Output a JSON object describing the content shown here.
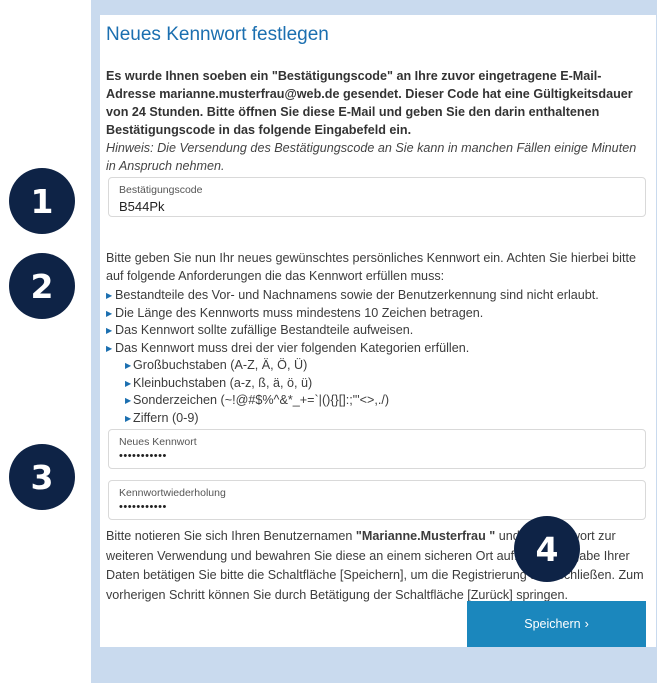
{
  "page": {
    "title": "Neues Kennwort festlegen",
    "intro_bold": "Es wurde Ihnen soeben ein \"Bestätigungscode\" an Ihre zuvor eingetragene E-Mail-Adresse marianne.musterfrau@web.de gesendet. Dieser Code hat eine Gültigkeitsdauer von 24 Stunden. Bitte öffnen Sie diese E-Mail und geben Sie den darin enthaltenen Bestätigungscode in das folgende Eingabefeld ein.",
    "intro_hint": "Hinweis: Die Versendung des Bestätigungscode an Sie kann in manchen Fällen einige Minuten in Anspruch nehmen."
  },
  "code_field": {
    "label": "Bestätigungscode",
    "value": "B544Pk"
  },
  "requirements": {
    "intro": "Bitte geben Sie nun Ihr neues gewünschtes persönliches Kennwort ein. Achten Sie hierbei bitte auf folgende Anforderungen die das Kennwort erfüllen muss:",
    "items": [
      "Bestandteile des Vor- und Nachnamens sowie der Benutzerkennung sind nicht erlaubt.",
      "Die Länge des Kennworts muss mindestens 10 Zeichen betragen.",
      "Das Kennwort sollte zufällige Bestandteile aufweisen.",
      "Das Kennwort muss drei der vier folgenden Kategorien erfüllen."
    ],
    "categories": [
      "Großbuchstaben (A-Z, Ä, Ö, Ü)",
      "Kleinbuchstaben (a-z, ß, ä, ö, ü)",
      "Sonderzeichen (~!@#$%^&*_+=`|(){}[]:;\"'<>,./)",
      "Ziffern (0-9)"
    ]
  },
  "new_password": {
    "label": "Neues Kennwort",
    "value": "•••••••••••"
  },
  "repeat_password": {
    "label": "Kennwortwiederholung",
    "value": "•••••••••••"
  },
  "closing": {
    "part1": "Bitte notieren Sie sich Ihren Benutzernamen ",
    "username": "\"Marianne.Musterfrau \"",
    "part2": " und Ihr Kennwort zur weiteren Verwendung und bewahren Sie diese an einem sicheren Ort auf. Nach Eingabe Ihrer Daten betätigen Sie bitte die Schaltfläche [Speichern], um die Registrierung abzuschließen. Zum vorherigen Schritt können Sie durch Betätigung der Schaltfläche [Zurück] springen."
  },
  "save_button": {
    "label": "Speichern",
    "arrow": "›"
  },
  "badges": [
    "1",
    "2",
    "3",
    "4"
  ],
  "colors": {
    "accent": "#1b87bd",
    "title": "#1b6fb0",
    "badge": "#0e2346",
    "frame": "#c9daee"
  }
}
